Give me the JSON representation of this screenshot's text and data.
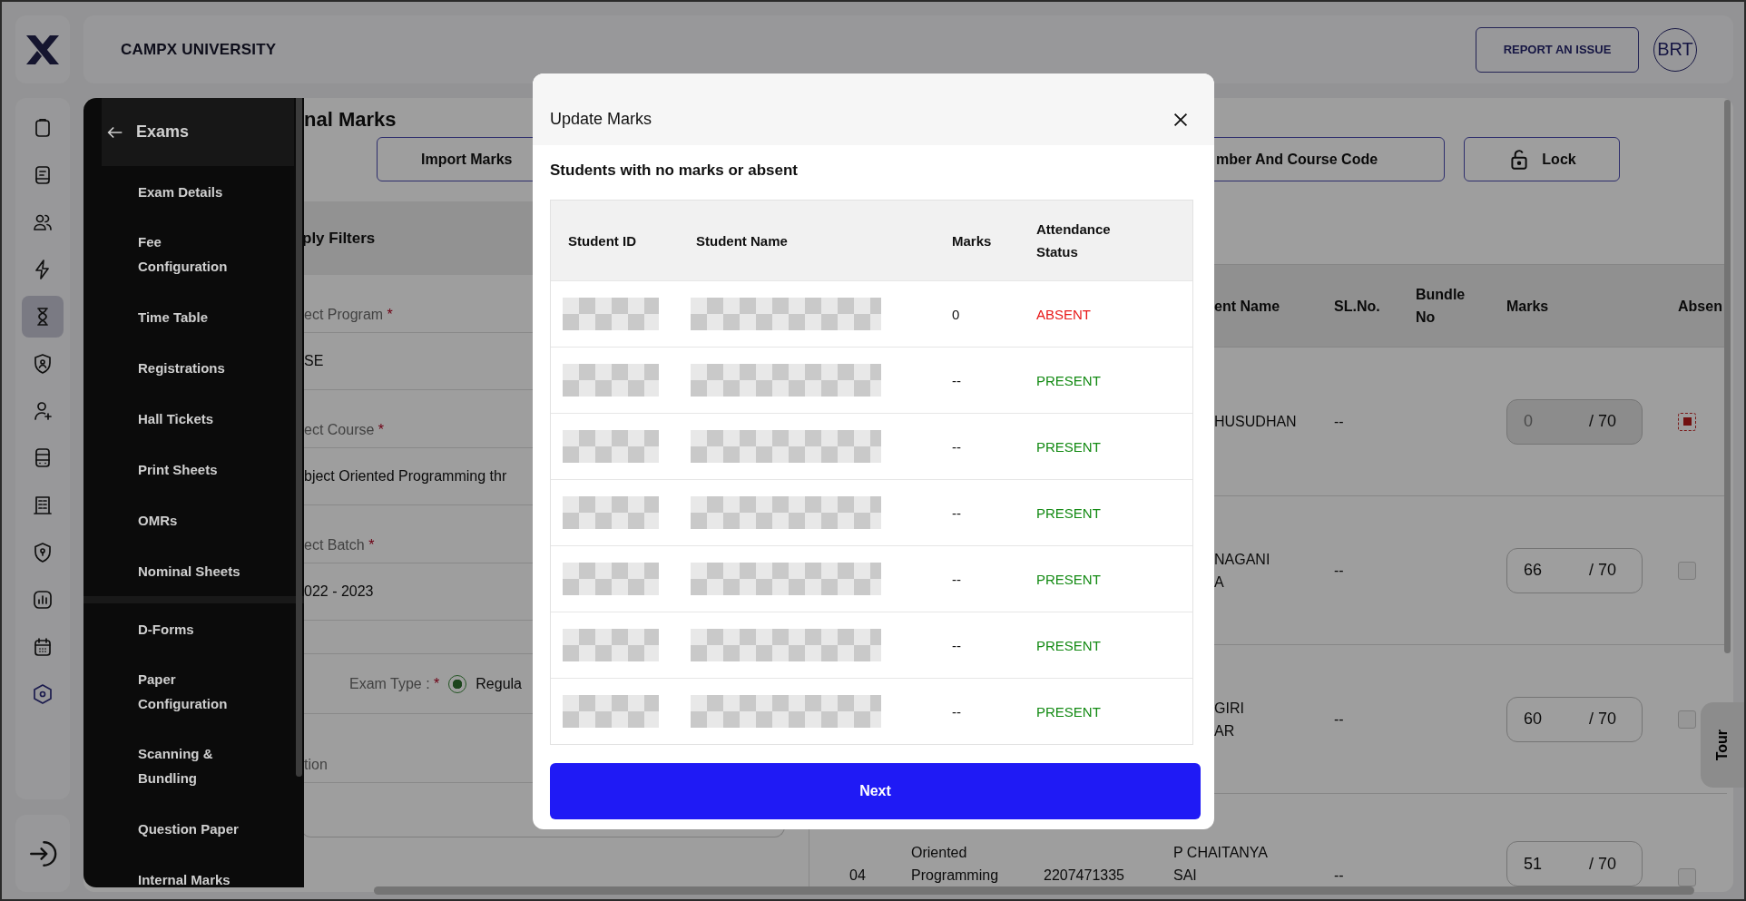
{
  "header": {
    "title": "CAMPX UNIVERSITY",
    "report_button": "REPORT AN ISSUE",
    "avatar": "BRT"
  },
  "rail": {
    "items": [
      {
        "selected": false
      },
      {
        "selected": false
      },
      {
        "selected": false
      },
      {
        "selected": false
      },
      {
        "selected": true
      },
      {
        "selected": false
      },
      {
        "selected": false
      },
      {
        "selected": false
      },
      {
        "selected": false
      },
      {
        "selected": false
      },
      {
        "selected": false
      },
      {
        "selected": false
      },
      {
        "selected": false
      }
    ]
  },
  "page": {
    "title": "nal Marks",
    "buttons": [
      {
        "label": "Import Marks",
        "kind": "plain"
      },
      {
        "label": "mber And Course Code",
        "kind": "plain"
      },
      {
        "label": "Lock",
        "kind": "lock"
      }
    ]
  },
  "filters": {
    "heading": "ply Filters",
    "fields": [
      {
        "label": "ect Program",
        "asterisk": "*",
        "value": "SE"
      },
      {
        "label": "ect Course",
        "asterisk": "*",
        "value": "bject Oriented Programming thr"
      },
      {
        "label": "ect Batch",
        "asterisk": "*",
        "value": "022 - 2023"
      }
    ],
    "exam_type": {
      "label": "Exam Type :",
      "asterisk": "*",
      "option": "Regula",
      "selected": true
    },
    "last_field": {
      "label": "tion"
    }
  },
  "table": {
    "columns": [
      "ent Name",
      "SL.No.",
      "Bundle No",
      "Marks",
      "Absen"
    ],
    "rows": [
      {
        "name_lines": [
          "HUSUDHAN"
        ],
        "sl_no": "--",
        "marks": "0",
        "out_of": "/ 70",
        "absent": true
      },
      {
        "name_lines": [
          "NAGANI",
          "A"
        ],
        "sl_no": "--",
        "marks": "66",
        "out_of": "/ 70",
        "absent": false
      },
      {
        "name_lines": [
          "GIRI",
          "AR"
        ],
        "sl_no": "--",
        "marks": "60",
        "out_of": "/ 70",
        "absent": false
      },
      {
        "number": "04",
        "course": "Oriented Programming",
        "code": "2207471335",
        "name_lines": [
          "P CHAITANYA",
          "SAI"
        ],
        "sl_no": "--",
        "marks": "51",
        "out_of": "/ 70",
        "absent": false
      }
    ]
  },
  "tour": {
    "label": "Tour"
  },
  "flyout": {
    "title": "Exams",
    "sections": [
      [
        "Exam Details",
        "Fee Configuration",
        "Time Table",
        "Registrations",
        "Hall Tickets",
        "Print Sheets",
        "OMRs",
        "Nominal Sheets"
      ],
      [
        "D-Forms",
        "Paper Configuration",
        "Scanning & Bundling",
        "Question Paper",
        "Internal Marks"
      ]
    ]
  },
  "modal": {
    "title": "Update Marks",
    "subtitle": "Students with no marks or absent",
    "columns": [
      "Student ID",
      "Student Name",
      "Marks",
      "Attendance Status"
    ],
    "rows": [
      {
        "marks": "0",
        "status": "ABSENT",
        "absent": true
      },
      {
        "marks": "--",
        "status": "PRESENT",
        "absent": false
      },
      {
        "marks": "--",
        "status": "PRESENT",
        "absent": false
      },
      {
        "marks": "--",
        "status": "PRESENT",
        "absent": false
      },
      {
        "marks": "--",
        "status": "PRESENT",
        "absent": false
      },
      {
        "marks": "--",
        "status": "PRESENT",
        "absent": false
      },
      {
        "marks": "--",
        "status": "PRESENT",
        "absent": false
      }
    ],
    "button": "Next"
  }
}
